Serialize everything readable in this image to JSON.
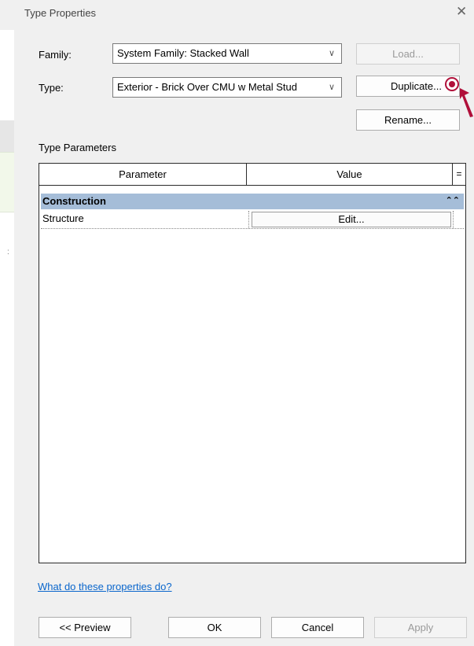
{
  "dialog": {
    "title": "Type Properties",
    "close_glyph": "✕"
  },
  "family": {
    "label": "Family:",
    "value": "System Family: Stacked Wall",
    "chevron": "∨"
  },
  "type": {
    "label": "Type:",
    "value": "Exterior - Brick Over CMU w Metal Stud",
    "chevron": "∨"
  },
  "buttons": {
    "load": "Load...",
    "duplicate": "Duplicate...",
    "rename": "Rename...",
    "preview": "<< Preview",
    "ok": "OK",
    "cancel": "Cancel",
    "apply": "Apply"
  },
  "type_parameters": {
    "label": "Type Parameters",
    "columns": [
      "Parameter",
      "Value",
      "="
    ],
    "groups": [
      {
        "name": "Construction",
        "collapse_glyph": "⌃⌃",
        "rows": [
          {
            "parameter": "Structure",
            "value": "Edit..."
          }
        ]
      }
    ]
  },
  "help_link": "What do these properties do?",
  "colors": {
    "group_header_bg": "#a5bdd8",
    "link": "#0a66cc",
    "annotation_marker": "#b0103a"
  },
  "icons": {
    "close": "close-icon",
    "dropdown": "chevron-down-icon",
    "collapse": "double-chevron-up-icon",
    "annotation": "annotation-marker-icon",
    "pointer": "pointer-arrow-icon"
  }
}
